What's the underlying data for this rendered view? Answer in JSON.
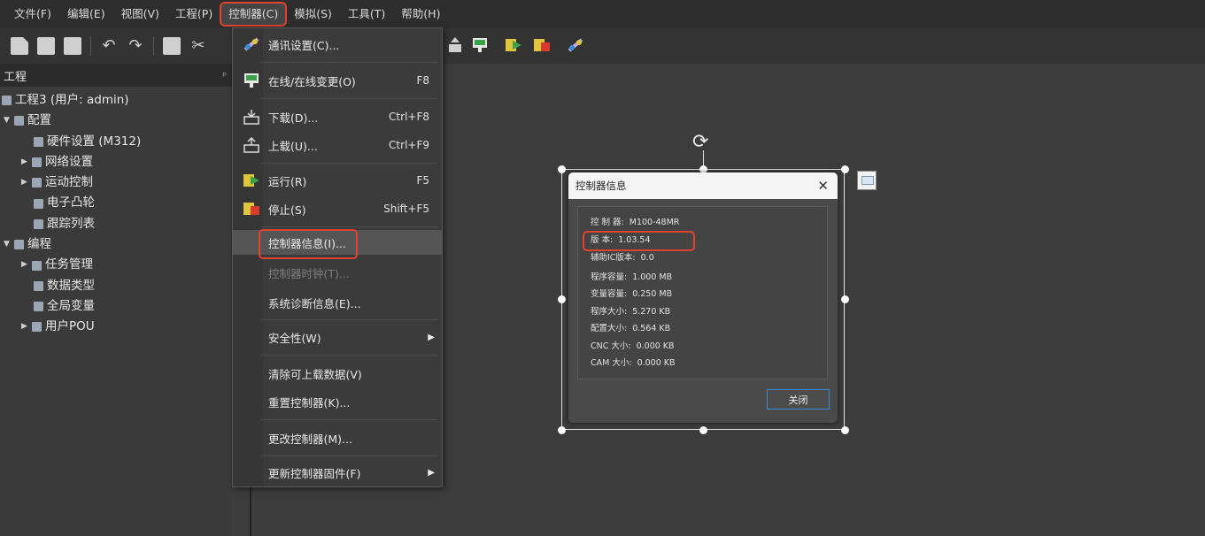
{
  "menubar": {
    "items": [
      {
        "label": "文件(F)"
      },
      {
        "label": "编辑(E)"
      },
      {
        "label": "视图(V)"
      },
      {
        "label": "工程(P)"
      },
      {
        "label": "控制器(C)"
      },
      {
        "label": "模拟(S)"
      },
      {
        "label": "工具(T)"
      },
      {
        "label": "帮助(H)"
      }
    ]
  },
  "left_panel": {
    "title": "工程",
    "pin": "ᵖ",
    "tree": [
      {
        "label": "工程3 (用户: admin)"
      },
      {
        "label": "配置",
        "caret": "▼"
      },
      {
        "label": "硬件设置 (M312)"
      },
      {
        "label": "网络设置",
        "caret": "▶"
      },
      {
        "label": "运动控制",
        "caret": "▶"
      },
      {
        "label": "电子凸轮"
      },
      {
        "label": "跟踪列表"
      },
      {
        "label": "编程",
        "caret": "▼"
      },
      {
        "label": "任务管理",
        "caret": "▶"
      },
      {
        "label": "数据类型"
      },
      {
        "label": "全局变量"
      },
      {
        "label": "用户POU",
        "caret": "▶"
      }
    ]
  },
  "context_menu": {
    "items": [
      {
        "label": "通讯设置(C)...",
        "shortcut": ""
      },
      {
        "label": "在线/在线变更(O)",
        "shortcut": "F8"
      },
      {
        "label": "下载(D)...",
        "shortcut": "Ctrl+F8"
      },
      {
        "label": "上载(U)...",
        "shortcut": "Ctrl+F9"
      },
      {
        "label": "运行(R)",
        "shortcut": "F5"
      },
      {
        "label": "停止(S)",
        "shortcut": "Shift+F5"
      },
      {
        "label": "控制器信息(I)..."
      },
      {
        "label": "控制器时钟(T)..."
      },
      {
        "label": "系统诊断信息(E)..."
      },
      {
        "label": "安全性(W)",
        "submenu": "▶"
      },
      {
        "label": "清除可上载数据(V)"
      },
      {
        "label": "重置控制器(K)..."
      },
      {
        "label": "更改控制器(M)..."
      },
      {
        "label": "更新控制器固件(F)",
        "submenu": "▶"
      }
    ]
  },
  "dialog": {
    "title": "控制器信息",
    "close_x": "✕",
    "rows": [
      {
        "label": "控 制 器:",
        "value": "M100-48MR"
      },
      {
        "label": "版      本:",
        "value": "1.03.54"
      },
      {
        "label": "辅助IC版本:",
        "value": "0.0"
      },
      {
        "label": "程序容量:",
        "value": "1.000 MB"
      },
      {
        "label": "变量容量:",
        "value": "0.250 MB"
      },
      {
        "label": "程序大小:",
        "value": "5.270 KB"
      },
      {
        "label": "配置大小:",
        "value": "0.564 KB"
      },
      {
        "label": "CNC 大小:",
        "value": "0.000 KB"
      },
      {
        "label": "CAM 大小:",
        "value": "0.000 KB"
      }
    ],
    "close_button": "关闭"
  },
  "colors": {
    "highlight_red": "#e0442f",
    "focus_blue": "#3a8bd6"
  }
}
